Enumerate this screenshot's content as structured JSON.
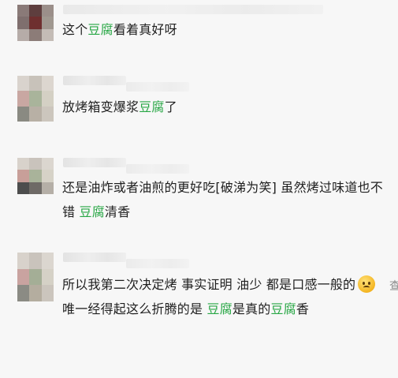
{
  "comments": [
    {
      "id": "c1",
      "segments": [
        {
          "t": "这个",
          "hl": false
        },
        {
          "t": "豆腐",
          "hl": true
        },
        {
          "t": "看着真好呀",
          "hl": false
        }
      ]
    },
    {
      "id": "c2",
      "segments": [
        {
          "t": "放烤箱变爆浆",
          "hl": false
        },
        {
          "t": "豆腐",
          "hl": true
        },
        {
          "t": "了",
          "hl": false
        }
      ]
    },
    {
      "id": "c3",
      "segments": [
        {
          "t": "还是油炸或者油煎的更好吃[破涕为笑] 虽然烤过味道也不错 ",
          "hl": false
        },
        {
          "t": "豆腐",
          "hl": true
        },
        {
          "t": "清香",
          "hl": false
        }
      ]
    },
    {
      "id": "c4",
      "segments": [
        {
          "t": "所以我第二次决定烤 事实证明 油少 都是口感一般的",
          "hl": false
        },
        {
          "emoji": "confused-face"
        },
        {
          "t": " 唯一经得起这么折腾的是 ",
          "hl": false
        },
        {
          "t": "豆腐",
          "hl": true
        },
        {
          "t": "是真的",
          "hl": false
        },
        {
          "t": "豆腐",
          "hl": true
        },
        {
          "t": "香",
          "hl": false
        }
      ],
      "side_glyph": "查"
    }
  ],
  "colors": {
    "highlight": "#28a745",
    "text": "#1f1f1f",
    "background": "#f7f7f7"
  }
}
